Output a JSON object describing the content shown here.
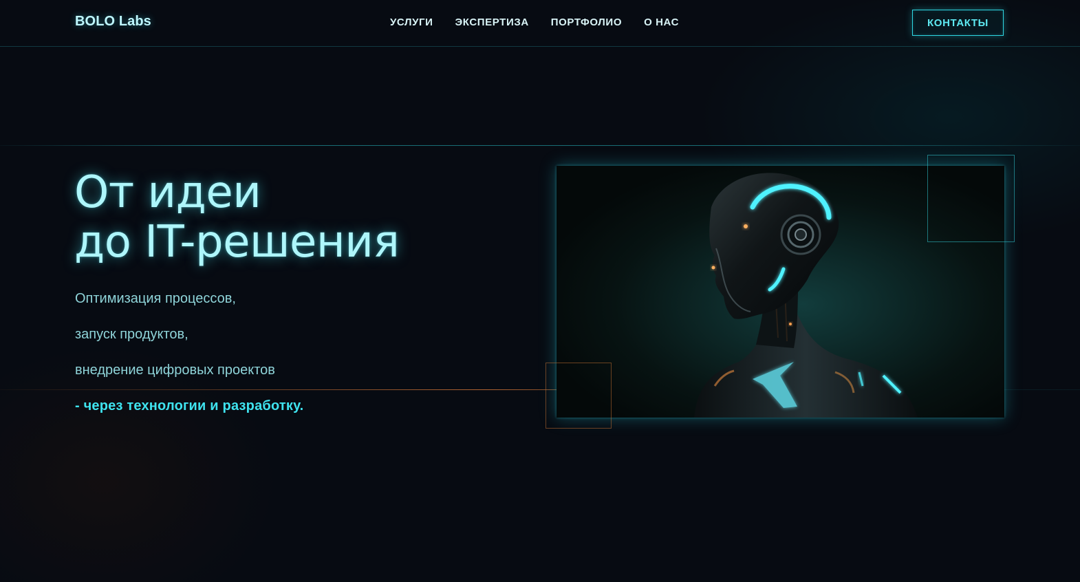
{
  "brand": {
    "name": "BOLO Labs"
  },
  "nav": {
    "items": [
      {
        "label": "УСЛУГИ"
      },
      {
        "label": "ЭКСПЕРТИЗА"
      },
      {
        "label": "ПОРТФОЛИО"
      },
      {
        "label": "О НАС"
      }
    ],
    "contact_label": "КОНТАКТЫ"
  },
  "hero": {
    "title_line1": "От идеи",
    "title_line2": "до IT-решения",
    "lines": [
      "Оптимизация процессов,",
      "запуск продуктов,",
      "внедрение цифровых проектов"
    ],
    "accent_line": "- через технологии и разработку."
  },
  "colors": {
    "background": "#070b12",
    "accent_cyan": "#3fe3ef",
    "headline": "#aef6fb",
    "text_muted": "#8fd4d9",
    "accent_orange": "#cd7337"
  }
}
